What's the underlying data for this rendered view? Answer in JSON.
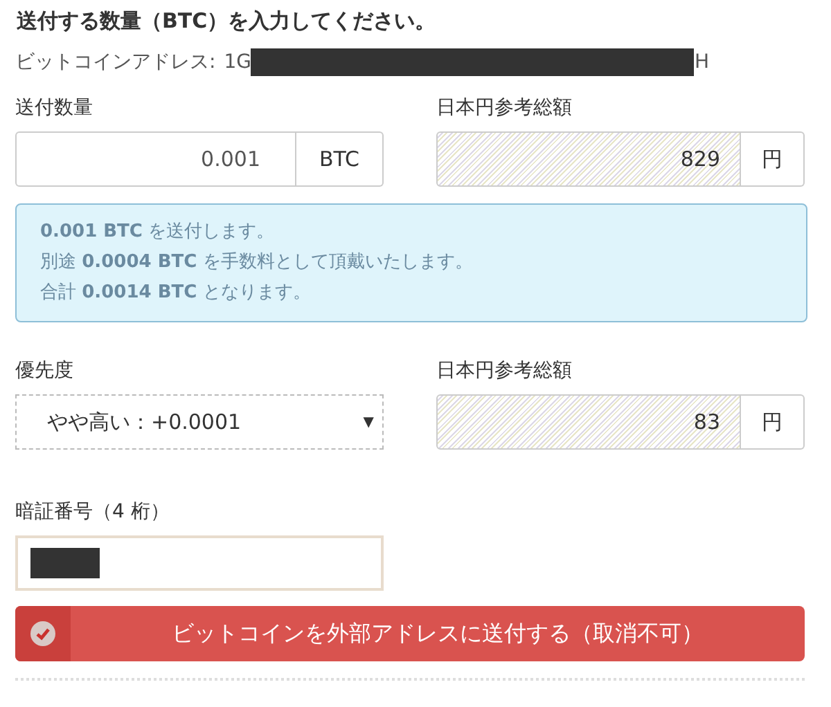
{
  "heading": "送付する数量（BTC）を入力してください。",
  "address": {
    "label": "ビットコインアドレス:",
    "start": "1G",
    "end": "H"
  },
  "amount": {
    "label": "送付数量",
    "value": "0.001",
    "unit": "BTC"
  },
  "amount_jpy": {
    "label": "日本円参考総額",
    "value": "829",
    "unit": "円",
    "readonly": true
  },
  "notice": [
    "**0.001 BTC** を送付します。",
    "別途 **0.0004 BTC** を手数料として頂戴いたします。",
    "合計 **0.0014 BTC** となります。"
  ],
  "priority": {
    "label": "優先度",
    "value": "やや高い：+0.0001",
    "arrow": "▼"
  },
  "fee_jpy": {
    "label": "日本円参考総額",
    "value": "83",
    "unit": "円",
    "readonly": true
  },
  "pin": {
    "label": "暗証番号（4 桁）"
  },
  "submit": {
    "label": "ビットコインを外部アドレスに送付する（取消不可）"
  }
}
